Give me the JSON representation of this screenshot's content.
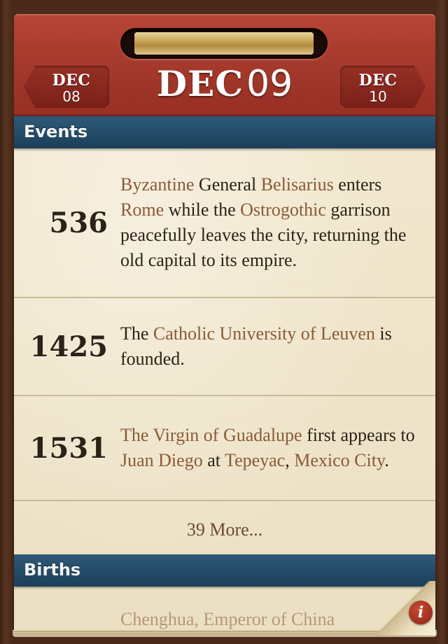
{
  "header": {
    "prev": {
      "month": "DEC",
      "day": "08"
    },
    "current": {
      "month": "DEC",
      "day": "09"
    },
    "next": {
      "month": "DEC",
      "day": "10"
    }
  },
  "sections": {
    "events_title": "Events",
    "births_title": "Births"
  },
  "events": [
    {
      "year": "536",
      "parts": [
        {
          "text": "Byzantine",
          "link": true
        },
        {
          "text": " General ",
          "link": false
        },
        {
          "text": "Belisarius",
          "link": true
        },
        {
          "text": " enters ",
          "link": false
        },
        {
          "text": "Rome",
          "link": true
        },
        {
          "text": " while the ",
          "link": false
        },
        {
          "text": "Ostrogothic",
          "link": true
        },
        {
          "text": " garrison peacefully leaves the city, returning the old capital to its empire.",
          "link": false
        }
      ]
    },
    {
      "year": "1425",
      "parts": [
        {
          "text": "The ",
          "link": false
        },
        {
          "text": "Catholic University of Leuven",
          "link": true
        },
        {
          "text": " is founded.",
          "link": false
        }
      ]
    },
    {
      "year": "1531",
      "parts": [
        {
          "text": "The Virgin of Guadalupe",
          "link": true
        },
        {
          "text": " first appears to ",
          "link": false
        },
        {
          "text": "Juan Diego",
          "link": true
        },
        {
          "text": " at ",
          "link": false
        },
        {
          "text": "Tepeyac",
          "link": true
        },
        {
          "text": ", ",
          "link": false
        },
        {
          "text": "Mexico City",
          "link": true
        },
        {
          "text": ".",
          "link": false
        }
      ]
    }
  ],
  "more_label": "39 More...",
  "births_peek": "Chenghua, Emperor of China",
  "info_icon": "i",
  "colors": {
    "header_red": "#a63a2d",
    "section_blue": "#234c69",
    "link_brown": "#8a5a38",
    "paper": "#efe4c9"
  }
}
